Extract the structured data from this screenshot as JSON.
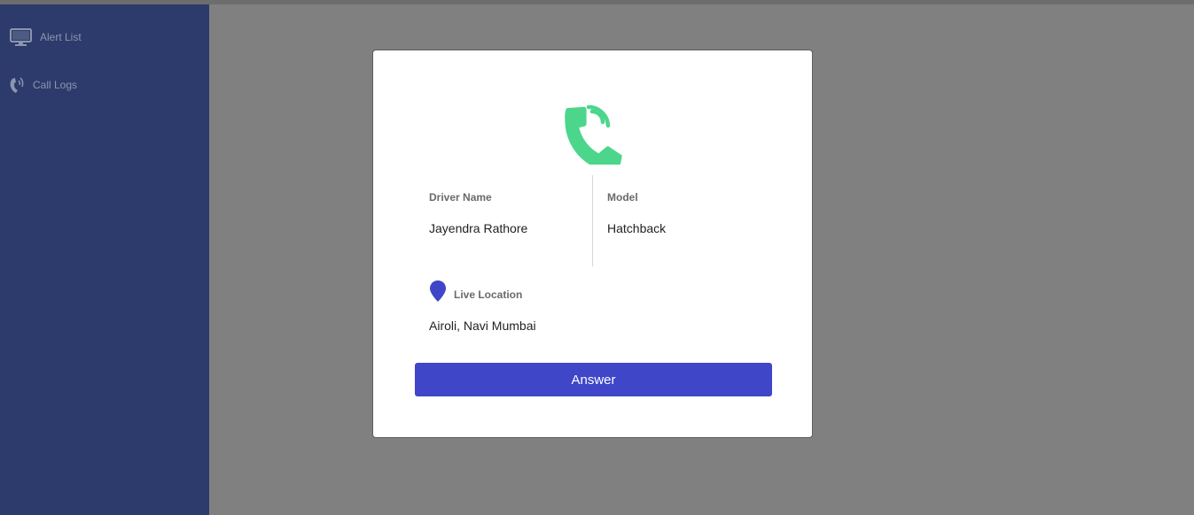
{
  "sidebar": {
    "items": [
      {
        "label": "Alert List",
        "icon": "monitor-icon"
      },
      {
        "label": "Call Logs",
        "icon": "phone-ringing-icon"
      }
    ]
  },
  "modal": {
    "icon": "incoming-call-icon",
    "driver_name_label": "Driver Name",
    "driver_name_value": "Jayendra Rathore",
    "model_label": "Model",
    "model_value": "Hatchback",
    "location_icon": "location-pin-icon",
    "location_label": "Live Location",
    "location_value": "Airoli, Navi Mumbai",
    "answer_label": "Answer"
  },
  "colors": {
    "sidebar_bg": "#2c3b6b",
    "overlay": "#808080",
    "call_icon": "#4cd68c",
    "accent": "#3f46c8"
  }
}
